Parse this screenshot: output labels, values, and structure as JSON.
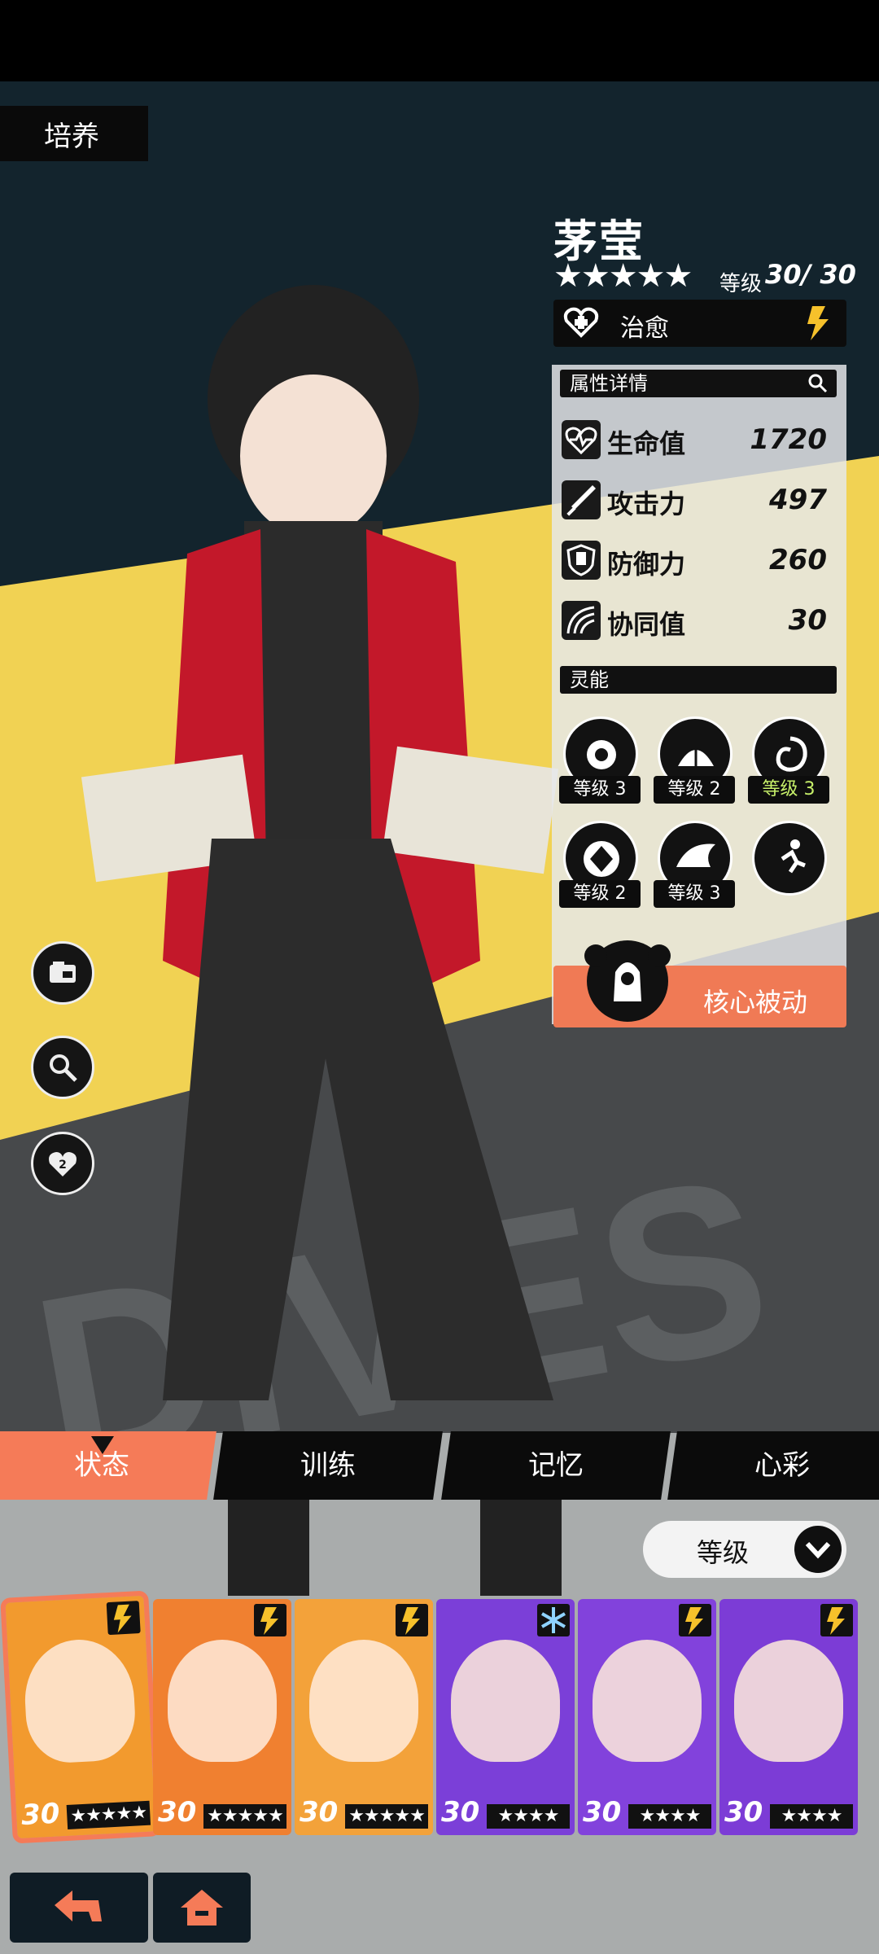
{
  "page_tag": "培养",
  "character": {
    "name": "茅莹",
    "stars": "★★★★★",
    "level_label": "等级",
    "level_value": "30/ 30",
    "role": "治愈"
  },
  "attributes": {
    "header": "属性详情",
    "stats": [
      {
        "label": "生命值",
        "value": "1720",
        "icon": "heart-pulse-icon"
      },
      {
        "label": "攻击力",
        "value": "497",
        "icon": "sword-icon"
      },
      {
        "label": "防御力",
        "value": "260",
        "icon": "shield-icon"
      },
      {
        "label": "协同值",
        "value": "30",
        "icon": "arcs-icon"
      }
    ]
  },
  "psionics": {
    "header": "灵能",
    "skills": [
      {
        "level": "等级 3",
        "highlight": false
      },
      {
        "level": "等级 2",
        "highlight": false
      },
      {
        "level": "等级 3",
        "highlight": true
      },
      {
        "level": "等级 2",
        "highlight": false
      },
      {
        "level": "等级 3",
        "highlight": false
      },
      {
        "level": "",
        "highlight": false
      }
    ]
  },
  "core_passive": "核心被动",
  "tabs": [
    {
      "label": "状态",
      "active": true
    },
    {
      "label": "训练",
      "active": false
    },
    {
      "label": "记忆",
      "active": false
    },
    {
      "label": "心彩",
      "active": false
    }
  ],
  "sort": {
    "label": "等级"
  },
  "roster": [
    {
      "level": "30",
      "stars": "★★★★★",
      "element": "lightning",
      "color": "#f29a2e",
      "selected": true
    },
    {
      "level": "30",
      "stars": "★★★★★",
      "element": "lightning",
      "color": "#f08030",
      "selected": false
    },
    {
      "level": "30",
      "stars": "★★★★★",
      "element": "lightning",
      "color": "#f3a23a",
      "selected": false
    },
    {
      "level": "30",
      "stars": "★★★★",
      "element": "ice",
      "color": "#7b3fd8",
      "selected": false
    },
    {
      "level": "30",
      "stars": "★★★★",
      "element": "lightning",
      "color": "#8242dc",
      "selected": false
    },
    {
      "level": "30",
      "stars": "★★★★",
      "element": "lightning",
      "color": "#7c3cd6",
      "selected": false
    }
  ],
  "colors": {
    "accent": "#f57b58",
    "highlight": "#c7f06a",
    "panel": "#e6e8eb"
  }
}
